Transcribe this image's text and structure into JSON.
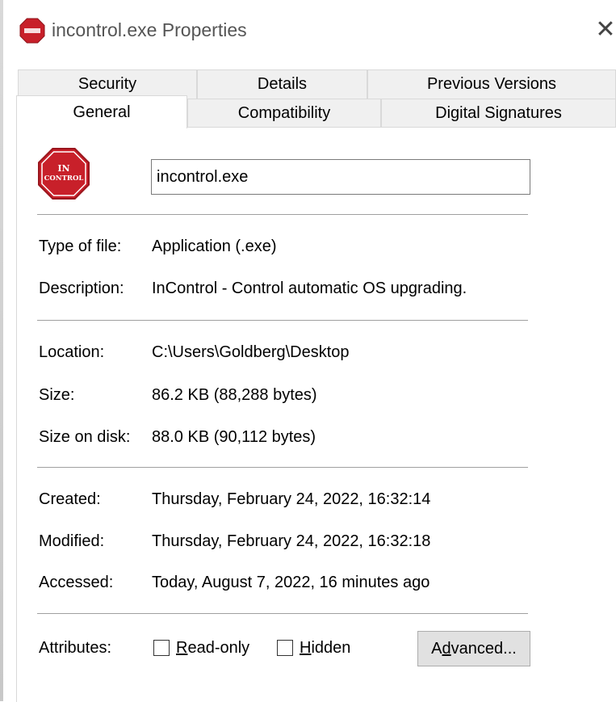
{
  "window": {
    "title": "incontrol.exe Properties",
    "close_glyph": "✕",
    "app_icon": "incontrol-stop-sign-icon"
  },
  "tabs": {
    "row_back": [
      "Security",
      "Details",
      "Previous Versions"
    ],
    "row_front": [
      "General",
      "Compatibility",
      "Digital Signatures"
    ],
    "active": "General"
  },
  "general": {
    "icon_text_line1": "IN",
    "icon_text_line2": "CONTROL",
    "file_name": "incontrol.exe",
    "type_label": "Type of file:",
    "type_value": "Application (.exe)",
    "description_label": "Description:",
    "description_value": "InControl - Control automatic OS upgrading.",
    "location_label": "Location:",
    "location_value": "C:\\Users\\Goldberg\\Desktop",
    "size_label": "Size:",
    "size_value": "86.2 KB (88,288 bytes)",
    "size_on_disk_label": "Size on disk:",
    "size_on_disk_value": "88.0 KB (90,112 bytes)",
    "created_label": "Created:",
    "created_value": "Thursday, February 24, 2022, 16:32:14",
    "modified_label": "Modified:",
    "modified_value": "Thursday, February 24, 2022, 16:32:18",
    "accessed_label": "Accessed:",
    "accessed_value": "Today, August 7, 2022, 16 minutes ago",
    "attributes_label": "Attributes:",
    "readonly_first": "R",
    "readonly_rest": "ead-only",
    "hidden_first": "H",
    "hidden_rest": "idden",
    "advanced_pre": "A",
    "advanced_u": "d",
    "advanced_post": "vanced...",
    "readonly_checked": false,
    "hidden_checked": false
  },
  "colors": {
    "icon_red": "#c8202a",
    "border": "#d9d9d9",
    "separator": "#a0a0a0"
  }
}
